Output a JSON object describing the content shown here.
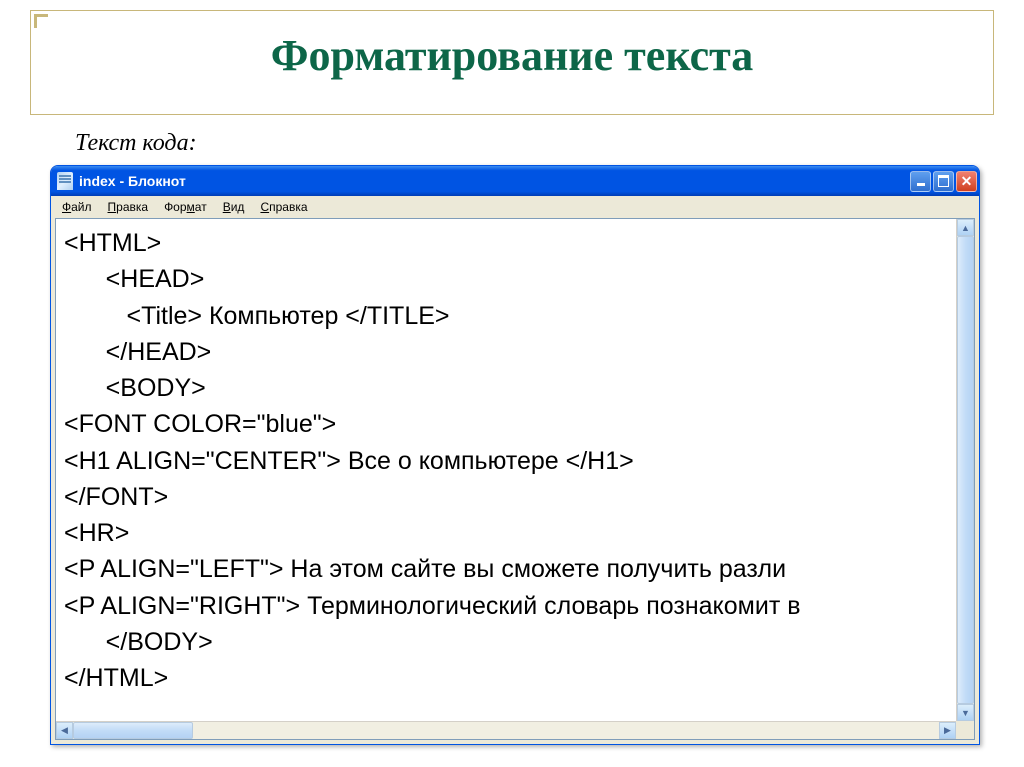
{
  "slide": {
    "title": "Форматирование текста",
    "subtitle": "Текст кода:"
  },
  "window": {
    "title": "index - Блокнот",
    "menu": {
      "file": "Файл",
      "edit": "Правка",
      "format": "Формат",
      "view": "Вид",
      "help": "Справка"
    }
  },
  "editor": {
    "line1": "<HTML>",
    "line2": "      <HEAD>",
    "line3": "         <Title> Компьютер </TITLE>",
    "line4": "      </HEAD>",
    "line5": "      <BODY>",
    "line6": "<FONT COLOR=\"blue\">",
    "line7": "<H1 ALIGN=\"CENTER\"> Все о компьютере </H1>",
    "line8": "</FONT>",
    "line9": "<HR>",
    "line10": "<P ALIGN=\"LEFT\"> На этом сайте вы сможете получить разли",
    "line11": "<P ALIGN=\"RIGHT\"> Терминологический словарь познакомит в",
    "line12": "      </BODY>",
    "line13": "</HTML>"
  }
}
